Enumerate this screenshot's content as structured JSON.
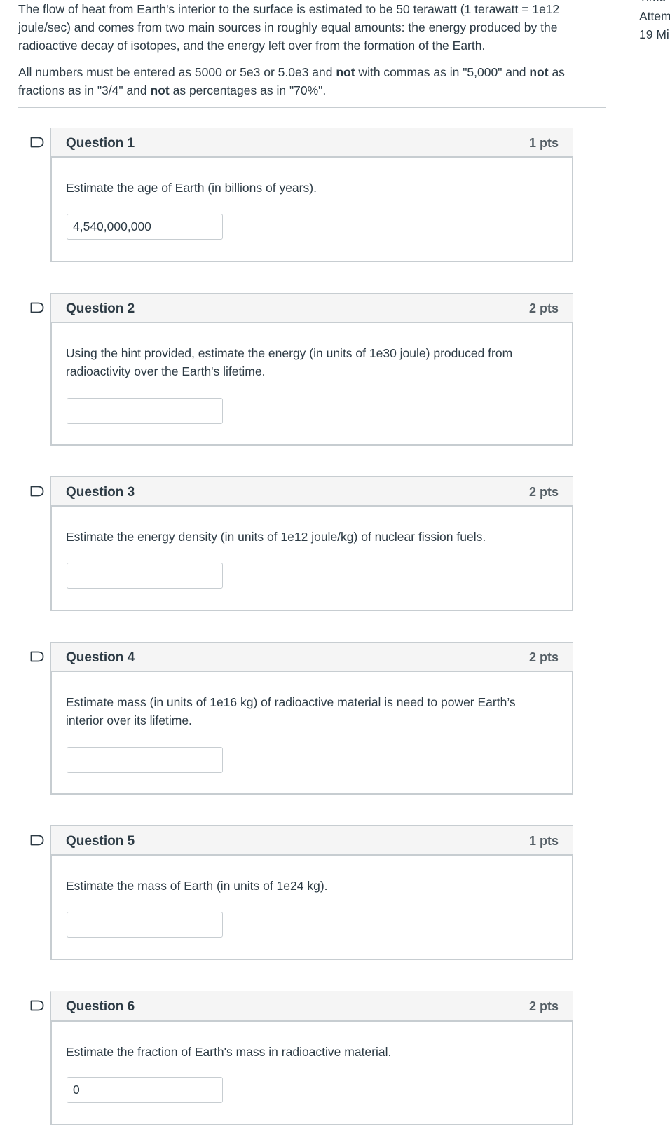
{
  "intro": {
    "paragraph1": "The flow of heat from Earth's interior to the surface is estimated to be 50 terawatt (1 terawatt = 1e12 joule/sec) and comes from two main sources in roughly equal amounts: the energy produced by the radioactive decay of isotopes, and the energy left over from the formation of the Earth.",
    "p2_part1": "All numbers must be entered as 5000 or 5e3 or 5.0e3 and ",
    "p2_bold1": "not",
    "p2_part2": " with commas as in \"5,000\" and ",
    "p2_bold2": "not",
    "p2_part3": " as fractions as in \"3/4\" and ",
    "p2_bold3": "not",
    "p2_part4": " as percentages as in \"70%\"."
  },
  "sidebar": {
    "line0": "Time",
    "line1": "Attem",
    "line2": "19 Mi"
  },
  "questions": [
    {
      "title": "Question 1",
      "points": "1 pts",
      "text": "Estimate the age of Earth (in billions of years).",
      "answer": "4,540,000,000"
    },
    {
      "title": "Question 2",
      "points": "2 pts",
      "text": "Using the hint provided, estimate the energy (in units of 1e30 joule) produced from radioactivity over the Earth's lifetime.",
      "answer": ""
    },
    {
      "title": "Question 3",
      "points": "2 pts",
      "text": "Estimate the energy density (in units of 1e12 joule/kg) of nuclear fission fuels.",
      "answer": ""
    },
    {
      "title": "Question 4",
      "points": "2 pts",
      "text": "Estimate mass (in units of 1e16 kg) of radioactive material is need to power Earth’s interior over its lifetime.",
      "answer": ""
    },
    {
      "title": "Question 5",
      "points": "1 pts",
      "text": "Estimate the mass of Earth (in units of 1e24 kg).",
      "answer": ""
    },
    {
      "title": "Question 6",
      "points": "2 pts",
      "text": "Estimate the fraction of Earth's mass in radioactive material.",
      "answer": "0"
    }
  ],
  "colors": {
    "text": "#2d3b45",
    "border": "#c7cdd1",
    "header_bg": "#f5f5f5",
    "points": "#555f66"
  },
  "icons": {
    "flag": "bookmark-flag-icon"
  }
}
